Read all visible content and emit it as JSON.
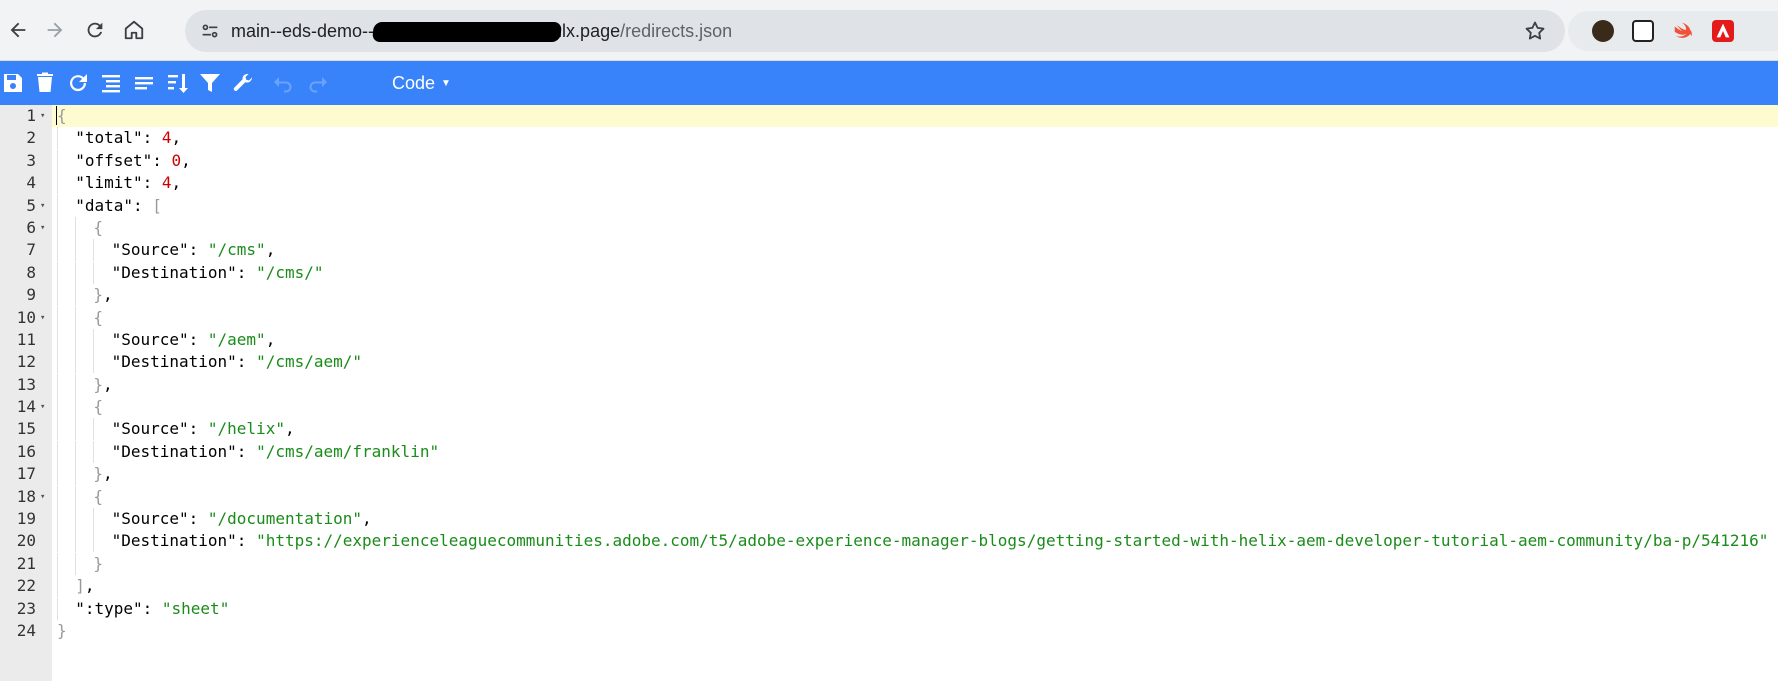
{
  "browser": {
    "url_host": "main--eds-demo--",
    "url_host_suffix": "hlx.page",
    "url_path": "/redirects.json"
  },
  "toolbar": {
    "mode_label": "Code",
    "icons": [
      "save-icon",
      "trash-icon",
      "refresh-icon",
      "format-icon",
      "compact-icon",
      "sort-icon",
      "filter-icon",
      "wrench-icon",
      "undo-icon",
      "redo-icon"
    ]
  },
  "colors": {
    "toolbar": "#3883fa",
    "number": "#cc0000",
    "string": "#1a8c1a",
    "active_line": "#fffbd1"
  },
  "json_lines": [
    {
      "n": "1",
      "fold": true,
      "indent": 0,
      "segs": [
        [
          "b",
          "{"
        ]
      ]
    },
    {
      "n": "2",
      "fold": false,
      "indent": 1,
      "segs": [
        [
          "k",
          "\"total\""
        ],
        [
          "p",
          ": "
        ],
        [
          "n",
          "4"
        ],
        [
          "p",
          ","
        ]
      ]
    },
    {
      "n": "3",
      "fold": false,
      "indent": 1,
      "segs": [
        [
          "k",
          "\"offset\""
        ],
        [
          "p",
          ": "
        ],
        [
          "n",
          "0"
        ],
        [
          "p",
          ","
        ]
      ]
    },
    {
      "n": "4",
      "fold": false,
      "indent": 1,
      "segs": [
        [
          "k",
          "\"limit\""
        ],
        [
          "p",
          ": "
        ],
        [
          "n",
          "4"
        ],
        [
          "p",
          ","
        ]
      ]
    },
    {
      "n": "5",
      "fold": true,
      "indent": 1,
      "segs": [
        [
          "k",
          "\"data\""
        ],
        [
          "p",
          ": "
        ],
        [
          "b",
          "["
        ]
      ]
    },
    {
      "n": "6",
      "fold": true,
      "indent": 2,
      "segs": [
        [
          "b",
          "{"
        ]
      ]
    },
    {
      "n": "7",
      "fold": false,
      "indent": 3,
      "segs": [
        [
          "k",
          "\"Source\""
        ],
        [
          "p",
          ": "
        ],
        [
          "s",
          "\"/cms\""
        ],
        [
          "p",
          ","
        ]
      ]
    },
    {
      "n": "8",
      "fold": false,
      "indent": 3,
      "segs": [
        [
          "k",
          "\"Destination\""
        ],
        [
          "p",
          ": "
        ],
        [
          "s",
          "\"/cms/\""
        ]
      ]
    },
    {
      "n": "9",
      "fold": false,
      "indent": 2,
      "segs": [
        [
          "b",
          "}"
        ],
        [
          "p",
          ","
        ]
      ]
    },
    {
      "n": "10",
      "fold": true,
      "indent": 2,
      "segs": [
        [
          "b",
          "{"
        ]
      ]
    },
    {
      "n": "11",
      "fold": false,
      "indent": 3,
      "segs": [
        [
          "k",
          "\"Source\""
        ],
        [
          "p",
          ": "
        ],
        [
          "s",
          "\"/aem\""
        ],
        [
          "p",
          ","
        ]
      ]
    },
    {
      "n": "12",
      "fold": false,
      "indent": 3,
      "segs": [
        [
          "k",
          "\"Destination\""
        ],
        [
          "p",
          ": "
        ],
        [
          "s",
          "\"/cms/aem/\""
        ]
      ]
    },
    {
      "n": "13",
      "fold": false,
      "indent": 2,
      "segs": [
        [
          "b",
          "}"
        ],
        [
          "p",
          ","
        ]
      ]
    },
    {
      "n": "14",
      "fold": true,
      "indent": 2,
      "segs": [
        [
          "b",
          "{"
        ]
      ]
    },
    {
      "n": "15",
      "fold": false,
      "indent": 3,
      "segs": [
        [
          "k",
          "\"Source\""
        ],
        [
          "p",
          ": "
        ],
        [
          "s",
          "\"/helix\""
        ],
        [
          "p",
          ","
        ]
      ]
    },
    {
      "n": "16",
      "fold": false,
      "indent": 3,
      "segs": [
        [
          "k",
          "\"Destination\""
        ],
        [
          "p",
          ": "
        ],
        [
          "s",
          "\"/cms/aem/franklin\""
        ]
      ]
    },
    {
      "n": "17",
      "fold": false,
      "indent": 2,
      "segs": [
        [
          "b",
          "}"
        ],
        [
          "p",
          ","
        ]
      ]
    },
    {
      "n": "18",
      "fold": true,
      "indent": 2,
      "segs": [
        [
          "b",
          "{"
        ]
      ]
    },
    {
      "n": "19",
      "fold": false,
      "indent": 3,
      "segs": [
        [
          "k",
          "\"Source\""
        ],
        [
          "p",
          ": "
        ],
        [
          "s",
          "\"/documentation\""
        ],
        [
          "p",
          ","
        ]
      ]
    },
    {
      "n": "20",
      "fold": false,
      "indent": 3,
      "segs": [
        [
          "k",
          "\"Destination\""
        ],
        [
          "p",
          ": "
        ],
        [
          "s",
          "\"https://experienceleaguecommunities.adobe.com/t5/adobe-experience-manager-blogs/getting-started-with-helix-aem-developer-tutorial-aem-community/ba-p/541216\""
        ]
      ]
    },
    {
      "n": "21",
      "fold": false,
      "indent": 2,
      "segs": [
        [
          "b",
          "}"
        ]
      ]
    },
    {
      "n": "22",
      "fold": false,
      "indent": 1,
      "segs": [
        [
          "b",
          "]"
        ],
        [
          "p",
          ","
        ]
      ]
    },
    {
      "n": "23",
      "fold": false,
      "indent": 1,
      "segs": [
        [
          "k",
          "\":type\""
        ],
        [
          "p",
          ": "
        ],
        [
          "s",
          "\"sheet\""
        ]
      ]
    },
    {
      "n": "24",
      "fold": false,
      "indent": 0,
      "segs": [
        [
          "b",
          "}"
        ]
      ]
    }
  ]
}
